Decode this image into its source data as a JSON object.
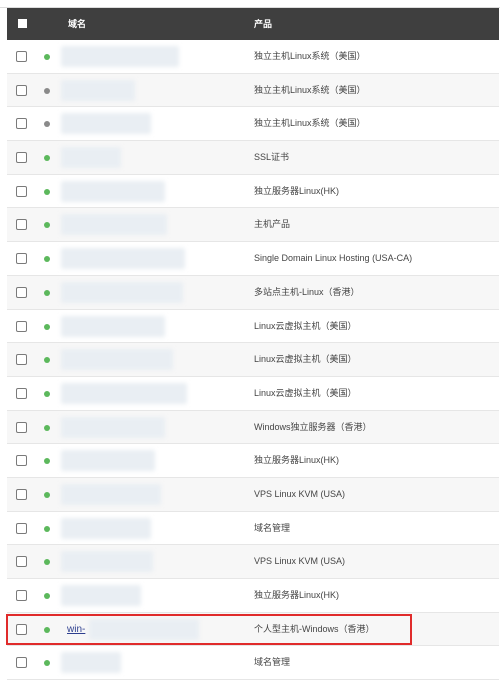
{
  "table": {
    "headers": {
      "domain": "域名",
      "product": "产品"
    },
    "status_colors": {
      "active": "#5cb85c",
      "inactive": "#8a8a8a"
    },
    "highlight_color": "#e02b2b",
    "rows": [
      {
        "status": "active",
        "domain": "",
        "product": "独立主机Linux系统（美国）"
      },
      {
        "status": "inactive",
        "domain": "",
        "product": "独立主机Linux系统（美国）"
      },
      {
        "status": "inactive",
        "domain": "",
        "product": "独立主机Linux系统（美国）"
      },
      {
        "status": "active",
        "domain": "",
        "product": "SSL证书"
      },
      {
        "status": "active",
        "domain": "",
        "product": "独立服务器Linux(HK)"
      },
      {
        "status": "active",
        "domain": "",
        "product": "主机产品"
      },
      {
        "status": "active",
        "domain": "",
        "product": "Single Domain Linux Hosting (USA-CA)"
      },
      {
        "status": "active",
        "domain": "",
        "product": "多站点主机-Linux（香港）"
      },
      {
        "status": "active",
        "domain": "",
        "product": "Linux云虚拟主机（美国）"
      },
      {
        "status": "active",
        "domain": "",
        "product": "Linux云虚拟主机（美国）"
      },
      {
        "status": "active",
        "domain": "",
        "product": "Linux云虚拟主机（美国）"
      },
      {
        "status": "active",
        "domain": "",
        "product": "Windows独立服务器（香港）"
      },
      {
        "status": "active",
        "domain": "",
        "product": "独立服务器Linux(HK)"
      },
      {
        "status": "active",
        "domain": "",
        "product": "VPS Linux KVM (USA)"
      },
      {
        "status": "active",
        "domain": "",
        "product": "域名管理"
      },
      {
        "status": "active",
        "domain": "",
        "product": "VPS Linux KVM (USA)"
      },
      {
        "status": "active",
        "domain": "",
        "product": "独立服务器Linux(HK)"
      },
      {
        "status": "active",
        "domain": "win-",
        "product": "个人型主机-Windows（香港）"
      },
      {
        "status": "active",
        "domain": "",
        "product": "域名管理"
      }
    ]
  }
}
